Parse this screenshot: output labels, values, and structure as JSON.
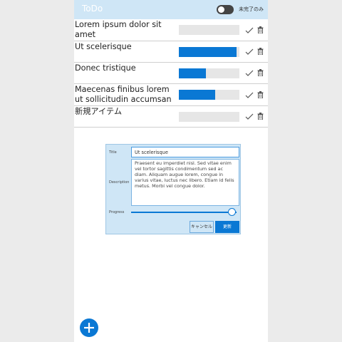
{
  "header": {
    "title": "ToDo",
    "toggle_label": "未完了のみ",
    "toggle_on": false
  },
  "todos": [
    {
      "title": "Lorem ipsum dolor sit amet",
      "progress": 0.0
    },
    {
      "title": "Ut scelerisque",
      "progress": 0.95
    },
    {
      "title": "Donec tristique",
      "progress": 0.45
    },
    {
      "title": "Maecenas finibus lorem ut sollicitudin accumsan",
      "progress": 0.6
    },
    {
      "title": "新規アイテム",
      "progress": 0.0
    }
  ],
  "icons": {
    "done": "check-icon",
    "delete": "trash-icon",
    "add": "plus-icon"
  },
  "dialog": {
    "title_label": "Title",
    "title_value": "Ut scelerisque",
    "description_label": "Description",
    "description_value": "Praesent eu imperdiet nisl. Sed vitae enim vel tortor sagittis condimentum sed ac diam. Aliquam augue lorem, congue in varius vitae, luctus nec libero. Etiam id felis metus. Morbi vel congue dolor.",
    "progress_label": "Progress",
    "progress": 0.95,
    "cancel_label": "キャンセル",
    "save_label": "更新"
  },
  "colors": {
    "accent": "#0a78d4",
    "header": "#cfe6f6"
  }
}
